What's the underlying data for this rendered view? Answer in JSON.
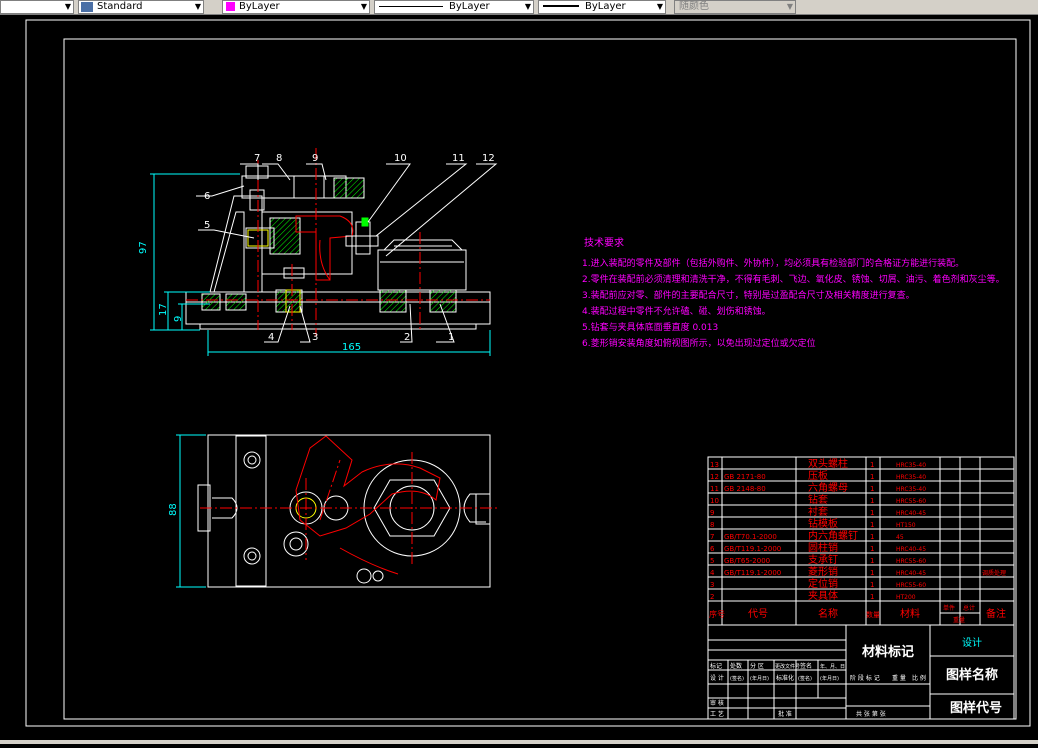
{
  "toolbar": {
    "style_name": "Standard",
    "color": "ByLayer",
    "color_swatch": "#ff00ff",
    "linetype": "ByLayer",
    "lineweight": "ByLayer",
    "plot_style": "随颜色"
  },
  "colors": {
    "frame": "#ffffff",
    "part": "#ffffff",
    "dimension": "#00ffff",
    "hatch": "#00ff00",
    "centerline": "#ff0000",
    "tech_text": "#ff00ff",
    "table_text": "#ff0000"
  },
  "drawing": {
    "balloons": [
      "7",
      "8",
      "9",
      "6",
      "5",
      "10",
      "11",
      "12",
      "4",
      "3",
      "2",
      "1"
    ],
    "dims": {
      "height_total": "97",
      "small_a": "17",
      "small_b": "9",
      "width": "165",
      "plan_height": "88"
    },
    "tech_title": "技术要求",
    "tech_lines": [
      "1.进入装配的零件及部件（包括外购件、外协件），均必须具有检验部门的合格证方能进行装配。",
      "2.零件在装配前必须清理和清洗干净，不得有毛刺、飞边、氧化皮、锈蚀、切屑、油污、着色剂和灰尘等。",
      "3.装配前应对零、部件的主要配合尺寸，特别是过盈配合尺寸及相关精度进行复查。",
      "4.装配过程中零件不允许磕、碰、划伤和锈蚀。",
      "5.钻套与夹具体底面垂直度 0.013",
      "6.菱形销安装角度如俯视图所示，以免出现过定位或欠定位"
    ]
  },
  "bom": {
    "rows": [
      {
        "no": "13",
        "code": "",
        "name": "双头螺柱",
        "qty": "1",
        "material": "HRC35-40",
        "note": ""
      },
      {
        "no": "12",
        "code": "GB 2171-80",
        "name": "压板",
        "qty": "1",
        "material": "HRC35-40",
        "note": ""
      },
      {
        "no": "11",
        "code": "GB 2148-80",
        "name": "六角螺母",
        "qty": "1",
        "material": "HRC35-40",
        "note": ""
      },
      {
        "no": "10",
        "code": "",
        "name": "钻套",
        "qty": "1",
        "material": "HRC55-60",
        "note": ""
      },
      {
        "no": "9",
        "code": "",
        "name": "衬套",
        "qty": "1",
        "material": "HRC40-45",
        "note": ""
      },
      {
        "no": "8",
        "code": "",
        "name": "钻模板",
        "qty": "1",
        "material": "HT150",
        "note": ""
      },
      {
        "no": "7",
        "code": "GB/T70.1-2000",
        "name": "内六角螺钉",
        "qty": "1",
        "material": "45",
        "note": ""
      },
      {
        "no": "6",
        "code": "GB/T119.1-2000",
        "name": "圆柱销",
        "qty": "1",
        "material": "HRC40-45",
        "note": ""
      },
      {
        "no": "5",
        "code": "GB/T65-2000",
        "name": "支承钉",
        "qty": "1",
        "material": "HRC55-60",
        "note": ""
      },
      {
        "no": "4",
        "code": "GB/T119.1-2000",
        "name": "菱形销",
        "qty": "1",
        "material": "HRC40-45",
        "note": "调质处理"
      },
      {
        "no": "3",
        "code": "",
        "name": "定位销",
        "qty": "1",
        "material": "HRC55-60",
        "note": ""
      },
      {
        "no": "2",
        "code": "",
        "name": "夹具体",
        "qty": "1",
        "material": "HT200",
        "note": ""
      }
    ],
    "header": {
      "seq": "序号",
      "code": "代号",
      "name": "名称",
      "qty": "数量",
      "material": "材料",
      "unit_weight": "单件",
      "total_weight": "总计",
      "weight": "重量",
      "note": "备注"
    }
  },
  "title_block": {
    "material_mark": "材料标记",
    "design": "设计",
    "drawing_name": "图样名称",
    "drawing_code": "图样代号",
    "mark": "标记",
    "count": "处数",
    "zone": "分 区",
    "change_doc": "更改文件号",
    "sign": "签名",
    "date": "年、月、日",
    "designer": "设 计",
    "standardize": "标准化",
    "stage": "阶 段 标 记",
    "weight": "重 量",
    "scale": "比 例",
    "review": "审 核",
    "process": "工 艺",
    "approve": "批 准",
    "sheets": "共 张 第 张",
    "signed": "(签名)",
    "ymd": "(年月日)"
  }
}
